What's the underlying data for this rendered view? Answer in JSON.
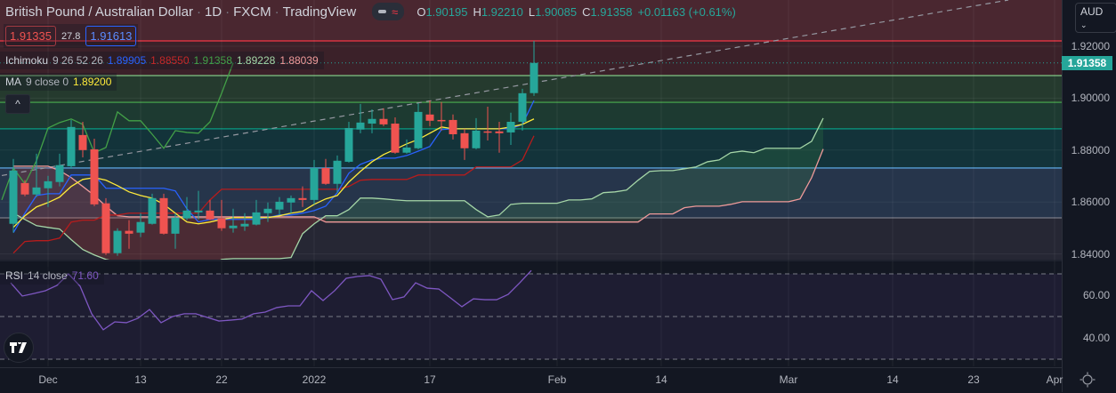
{
  "header": {
    "symbol": "British Pound / Australian Dollar",
    "interval": "1D",
    "exchange": "FXCM",
    "source": "TradingView",
    "sep": "·",
    "ohlc": {
      "o_label": "O",
      "o": "1.90195",
      "h_label": "H",
      "h": "1.92210",
      "l_label": "L",
      "l": "1.90085",
      "c_label": "C",
      "c": "1.91358",
      "change": "+0.01163 (+0.61%)"
    }
  },
  "trade": {
    "sell": "1.91335",
    "spread": "27.8",
    "buy": "1.91613"
  },
  "ichimoku": {
    "name": "Ichimoku",
    "params": "9 26 52 26",
    "v1": "1.89905",
    "v2": "1.88550",
    "v3": "1.91358",
    "v4": "1.89228",
    "v5": "1.88039"
  },
  "ma": {
    "name": "MA",
    "params": "9 close 0",
    "value": "1.89200"
  },
  "rsi_legend": {
    "name": "RSI",
    "params": "14 close",
    "value": "71.60"
  },
  "collapse_icon": "chevron-up-icon",
  "currency": "AUD",
  "current_price": "1.91358",
  "price_ticks": [
    "1.92000",
    "1.90000",
    "1.88000",
    "1.86000",
    "1.84000"
  ],
  "rsi_ticks": [
    "60.00",
    "40.00"
  ],
  "colors": {
    "up": "#26a69a",
    "down": "#ef5350",
    "tenkan": "#2962ff",
    "kijun": "#b71c1c",
    "chikou": "#43a047",
    "spanA": "#a5d6a7",
    "spanB": "#ef9a9a",
    "ma": "#ffeb3b",
    "rsi": "#7e57c2"
  },
  "x_labels": [
    {
      "text": "Dec",
      "bar": 3
    },
    {
      "text": "13",
      "bar": 11
    },
    {
      "text": "22",
      "bar": 18
    },
    {
      "text": "2022",
      "bar": 26
    },
    {
      "text": "17",
      "bar": 36
    },
    {
      "text": "Feb",
      "bar": 47
    },
    {
      "text": "14",
      "bar": 56
    },
    {
      "text": "Mar",
      "bar": 67
    },
    {
      "text": "14",
      "bar": 76
    },
    {
      "text": "23",
      "bar": 83
    },
    {
      "text": "Apr",
      "bar": 90
    }
  ],
  "chart_data": {
    "type": "candlestick",
    "price_range": [
      1.836,
      1.938
    ],
    "rsi_range": [
      25,
      85
    ],
    "fib_levels": [
      {
        "price": 1.92205,
        "color": "#f23645",
        "fill": "#3b2129"
      },
      {
        "price": 1.9087,
        "color": "#81c784",
        "fill": "#253a2e"
      },
      {
        "price": 1.8984,
        "color": "#4caf50",
        "fill": "#1d3a31"
      },
      {
        "price": 1.8882,
        "color": "#089981",
        "fill": "#13333a"
      },
      {
        "price": 1.8731,
        "color": "#64b5f6",
        "fill": "#26354b"
      },
      {
        "price": 1.8539,
        "color": "#787b86",
        "fill": "#262734"
      },
      {
        "price": 1.83,
        "color": "#1b2657",
        "fill": "#1b2657"
      }
    ],
    "top_zone_fill": "#4a2730",
    "candles": [
      [
        1.8516,
        1.8766,
        1.8482,
        1.8721
      ],
      [
        1.8673,
        1.8684,
        1.8622,
        1.8629
      ],
      [
        1.8629,
        1.8786,
        1.8619,
        1.8656
      ],
      [
        1.8653,
        1.8701,
        1.8581,
        1.868
      ],
      [
        1.8677,
        1.8786,
        1.866,
        1.8742
      ],
      [
        1.8738,
        1.8916,
        1.8728,
        1.8889
      ],
      [
        1.8858,
        1.8909,
        1.8772,
        1.88
      ],
      [
        1.8803,
        1.8844,
        1.8584,
        1.8591
      ],
      [
        1.8595,
        1.8615,
        1.8396,
        1.8403
      ],
      [
        1.8403,
        1.8499,
        1.8393,
        1.8489
      ],
      [
        1.8489,
        1.853,
        1.842,
        1.8478
      ],
      [
        1.8482,
        1.8557,
        1.8465,
        1.8523
      ],
      [
        1.8516,
        1.8632,
        1.8513,
        1.8615
      ],
      [
        1.8615,
        1.8632,
        1.8475,
        1.8478
      ],
      [
        1.8478,
        1.8557,
        1.842,
        1.854
      ],
      [
        1.8537,
        1.8619,
        1.853,
        1.8567
      ],
      [
        1.856,
        1.8643,
        1.8533,
        1.8567
      ],
      [
        1.8567,
        1.8608,
        1.853,
        1.8533
      ],
      [
        1.8537,
        1.8608,
        1.8489,
        1.8499
      ],
      [
        1.8499,
        1.8574,
        1.8482,
        1.8509
      ],
      [
        1.8506,
        1.8557,
        1.8489,
        1.8516
      ],
      [
        1.8513,
        1.8608,
        1.851,
        1.856
      ],
      [
        1.8557,
        1.8598,
        1.8523,
        1.8574
      ],
      [
        1.8571,
        1.8619,
        1.855,
        1.8601
      ],
      [
        1.8598,
        1.8625,
        1.8557,
        1.8615
      ],
      [
        1.8615,
        1.866,
        1.8581,
        1.8608
      ],
      [
        1.8608,
        1.8762,
        1.8591,
        1.8731
      ],
      [
        1.8731,
        1.8766,
        1.8666,
        1.867
      ],
      [
        1.867,
        1.8779,
        1.8636,
        1.8759
      ],
      [
        1.8755,
        1.8909,
        1.8752,
        1.8885
      ],
      [
        1.8879,
        1.8978,
        1.8865,
        1.8906
      ],
      [
        1.8902,
        1.8957,
        1.8865,
        1.892
      ],
      [
        1.892,
        1.8961,
        1.8892,
        1.8899
      ],
      [
        1.8902,
        1.8926,
        1.8786,
        1.879
      ],
      [
        1.879,
        1.8841,
        1.8786,
        1.881
      ],
      [
        1.8807,
        1.8981,
        1.8803,
        1.8947
      ],
      [
        1.8937,
        1.8991,
        1.8892,
        1.8913
      ],
      [
        1.8916,
        1.8985,
        1.8875,
        1.8913
      ],
      [
        1.8916,
        1.8937,
        1.8841,
        1.8861
      ],
      [
        1.8865,
        1.8882,
        1.8762,
        1.8807
      ],
      [
        1.8807,
        1.8923,
        1.8803,
        1.8875
      ],
      [
        1.8872,
        1.8967,
        1.8837,
        1.8868
      ],
      [
        1.8872,
        1.8909,
        1.879,
        1.8865
      ],
      [
        1.8868,
        1.8944,
        1.882,
        1.8909
      ],
      [
        1.8909,
        1.9036,
        1.8875,
        1.9019
      ],
      [
        1.90195,
        1.9221,
        1.90085,
        1.91358
      ]
    ],
    "tenkan": [
      1.8482,
      1.8557,
      1.8625,
      1.8632,
      1.8632,
      1.8704,
      1.8704,
      1.8704,
      1.8653,
      1.8653,
      1.8653,
      1.8653,
      1.8653,
      1.8653,
      1.8643,
      1.8574,
      1.8523,
      1.8533,
      1.8533,
      1.8533,
      1.8533,
      1.8533,
      1.854,
      1.855,
      1.855,
      1.8557,
      1.8567,
      1.8584,
      1.8636,
      1.8711,
      1.8745,
      1.8762,
      1.8769,
      1.8769,
      1.8779,
      1.8796,
      1.8814,
      1.8879,
      1.8882,
      1.8882,
      1.8882,
      1.8882,
      1.8882,
      1.8882,
      1.8899,
      1.8991
    ],
    "kijun": [
      1.8403,
      1.8448,
      1.8451,
      1.8451,
      1.8461,
      1.8523,
      1.853,
      1.853,
      1.855,
      1.855,
      1.8557,
      1.8557,
      1.8557,
      1.8557,
      1.8557,
      1.8557,
      1.8557,
      1.8608,
      1.8649,
      1.8649,
      1.8649,
      1.8649,
      1.8649,
      1.8649,
      1.8649,
      1.8649,
      1.8649,
      1.8649,
      1.8649,
      1.866,
      1.8684,
      1.8687,
      1.8687,
      1.8687,
      1.8687,
      1.8704,
      1.8704,
      1.8704,
      1.8704,
      1.8704,
      1.8735,
      1.8735,
      1.8735,
      1.8735,
      1.8762,
      1.8855
    ],
    "chikou_shift": 26,
    "cloud_shift": 25,
    "span_a": [
      1.8557,
      1.8533,
      1.8509,
      1.8502,
      1.8496,
      1.8455,
      1.8417,
      1.8396,
      1.8379,
      1.8369,
      1.835,
      1.835,
      1.835,
      1.835,
      1.835,
      1.835,
      1.835,
      1.835,
      1.8379,
      1.8382,
      1.8382,
      1.8382,
      1.8382,
      1.8382,
      1.8386,
      1.8478,
      1.8516,
      1.8547,
      1.8547,
      1.8571,
      1.8615,
      1.8615,
      1.8612,
      1.8608,
      1.8605,
      1.8605,
      1.8605,
      1.8605,
      1.8605,
      1.8605,
      1.8571,
      1.8543,
      1.855,
      1.8591,
      1.8595,
      1.8595,
      1.8595,
      1.8595,
      1.8608,
      1.8608,
      1.8612,
      1.8636,
      1.8639,
      1.8646,
      1.8684,
      1.8718,
      1.8721,
      1.8721,
      1.8728,
      1.8735,
      1.8755,
      1.8762,
      1.879,
      1.8796,
      1.879,
      1.8807,
      1.8807,
      1.8807,
      1.8807,
      1.8834,
      1.8923
    ],
    "span_b": [
      1.8738,
      1.8738,
      1.8738,
      1.8738,
      1.8721,
      1.8694,
      1.866,
      1.8625,
      1.8584,
      1.8547,
      1.8543,
      1.8543,
      1.8543,
      1.8543,
      1.8543,
      1.8543,
      1.8543,
      1.8543,
      1.8543,
      1.8543,
      1.8543,
      1.8543,
      1.8543,
      1.8543,
      1.8543,
      1.8543,
      1.8543,
      1.8523,
      1.8523,
      1.8523,
      1.8523,
      1.8523,
      1.8523,
      1.8523,
      1.8523,
      1.8523,
      1.8523,
      1.8523,
      1.8523,
      1.8523,
      1.8523,
      1.8523,
      1.8523,
      1.8523,
      1.8523,
      1.8523,
      1.8523,
      1.8523,
      1.8523,
      1.8523,
      1.8523,
      1.8523,
      1.8523,
      1.8523,
      1.8523,
      1.8554,
      1.8554,
      1.8554,
      1.8578,
      1.8584,
      1.8584,
      1.8584,
      1.8591,
      1.8601,
      1.8601,
      1.8601,
      1.8601,
      1.8601,
      1.8612,
      1.8694,
      1.8804
    ],
    "ma9": [
      1.8502,
      1.8547,
      1.8581,
      1.8598,
      1.8619,
      1.866,
      1.8687,
      1.8694,
      1.8684,
      1.8663,
      1.8639,
      1.8625,
      1.8615,
      1.8591,
      1.8557,
      1.8523,
      1.8516,
      1.8523,
      1.8533,
      1.854,
      1.854,
      1.854,
      1.854,
      1.8547,
      1.8557,
      1.8564,
      1.8591,
      1.8612,
      1.8625,
      1.8677,
      1.8718,
      1.8755,
      1.8783,
      1.8803,
      1.8824,
      1.8841,
      1.8865,
      1.8889,
      1.8882,
      1.8882,
      1.8882,
      1.8882,
      1.8882,
      1.8889,
      1.8899,
      1.892
    ],
    "rsi": [
      65.8,
      59.6,
      60.8,
      62.1,
      64.6,
      70.0,
      64.2,
      51.3,
      43.8,
      47.5,
      47.1,
      49.2,
      53.3,
      47.1,
      50.0,
      51.3,
      51.3,
      49.6,
      47.9,
      48.3,
      48.8,
      51.3,
      52.1,
      54.2,
      55.0,
      55.0,
      62.1,
      57.5,
      62.1,
      67.9,
      68.8,
      69.2,
      67.5,
      57.9,
      59.2,
      65.8,
      63.3,
      62.9,
      58.8,
      54.6,
      58.3,
      57.9,
      57.9,
      60.4,
      65.8,
      71.6
    ],
    "rsi_levels": [
      70,
      50,
      30
    ],
    "trendline": {
      "from_bar": -1,
      "from_price": 1.8702,
      "to_bar": 86,
      "to_price": 1.9378
    }
  }
}
